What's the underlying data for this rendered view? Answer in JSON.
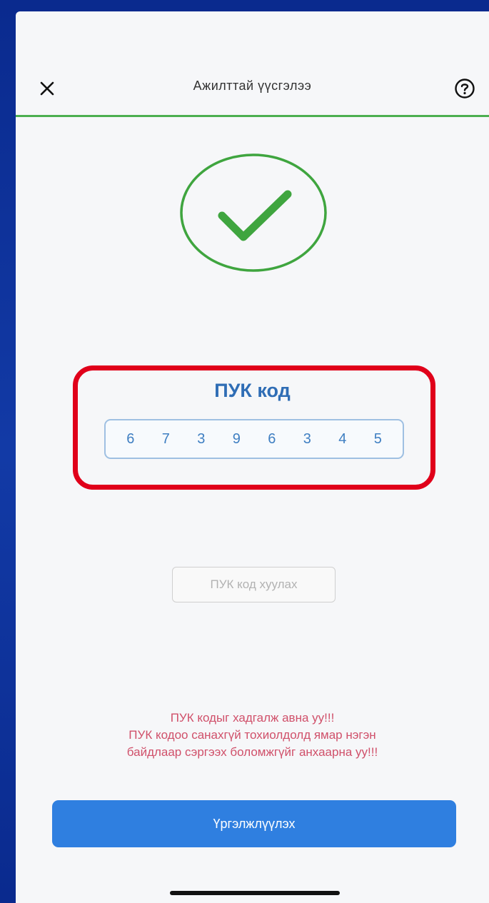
{
  "header": {
    "title": "Ажилттай үүсгэлээ",
    "close_icon": "close-icon",
    "help_icon": "help-icon"
  },
  "progress": {
    "value": 1.0,
    "color": "#4caf50"
  },
  "success": {
    "icon": "checkmark-circle-icon",
    "color": "#3fa53f"
  },
  "puk": {
    "label": "ПУК код",
    "digits": [
      "6",
      "7",
      "3",
      "9",
      "6",
      "3",
      "4",
      "5"
    ],
    "highlight_color": "#e0001a"
  },
  "copy_button": {
    "label": "ПУК код хуулах"
  },
  "warning": {
    "line1": "ПУК кодыг хадгалж авна уу!!!",
    "line2": "ПУК кодоо санахгүй тохиолдолд ямар нэгэн",
    "line3": "байдлаар сэргээх боломжгүйг анхаарна уу!!!",
    "color": "#d0506a"
  },
  "continue_button": {
    "label": "Үргэлжлүүлэх",
    "color": "#2f7fe0"
  }
}
